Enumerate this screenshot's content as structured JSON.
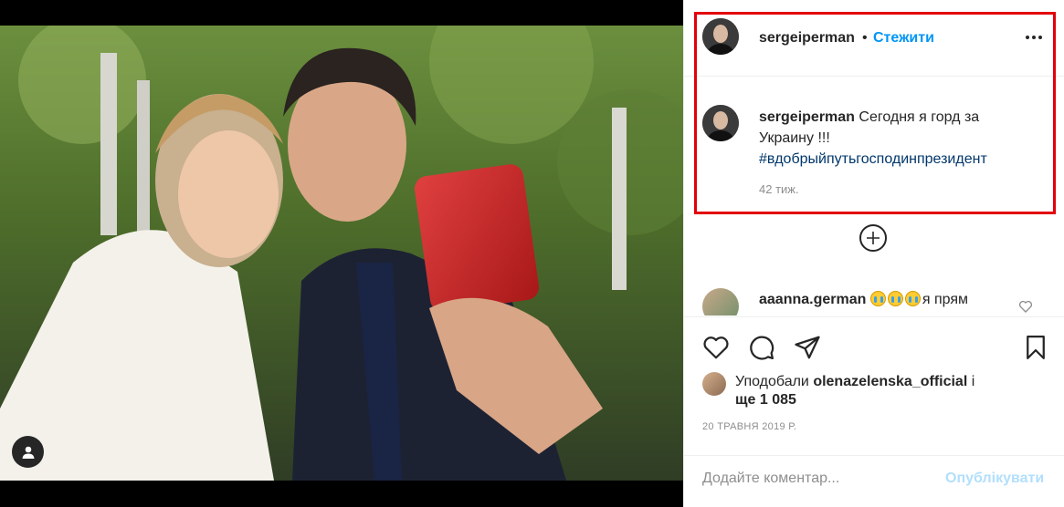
{
  "post": {
    "author": "sergeiperman",
    "separator": "•",
    "follow_label": "Стежити",
    "more_icon": "more-options-icon"
  },
  "caption": {
    "username": "sergeiperman",
    "text": "Сегодня я горд за Украину !!!",
    "hashtag": "#вдобрыйпутьгосподинпрезидент",
    "time": "42 тиж."
  },
  "comments": [
    {
      "username": "aaanna.german",
      "text": "я прям",
      "overflow": "..."
    }
  ],
  "likes": {
    "prefix": "Уподобали",
    "user": "olenazelenska_official",
    "conj": "і",
    "more": "ще 1 085"
  },
  "date": "20 ТРАВНЯ 2019 Р.",
  "add_comment": {
    "placeholder": "Додайте коментар...",
    "publish_label": "Опублікувати"
  },
  "colors": {
    "accent": "#0095f6",
    "highlight_border": "#e3000b",
    "hashtag": "#00376b",
    "muted": "#8e8e8e",
    "publish_disabled": "#b2dffc"
  }
}
